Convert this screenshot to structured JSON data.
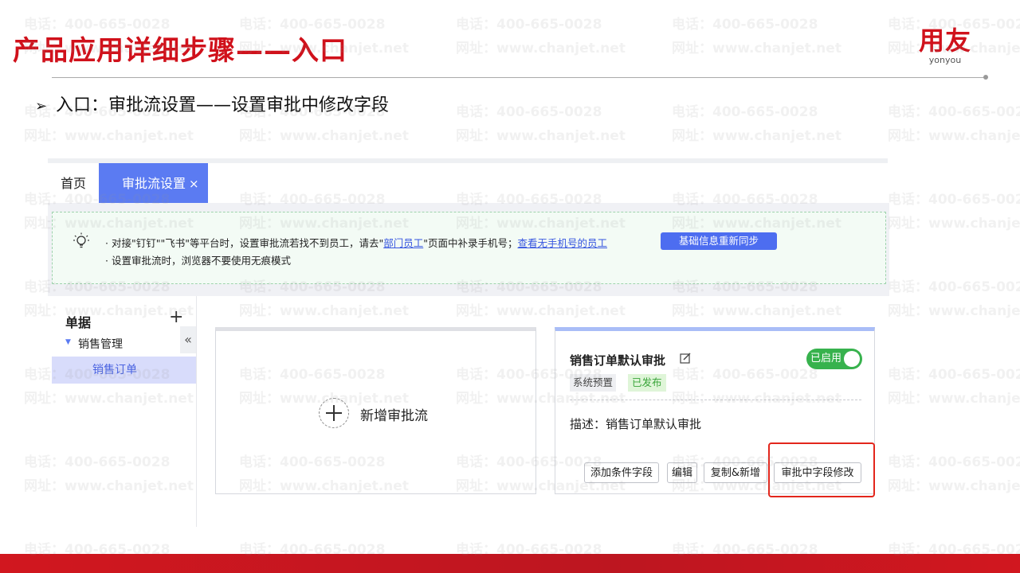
{
  "slide": {
    "title": "产品应用详细步骤——入口",
    "bullet": "入口：审批流设置——设置审批中修改字段",
    "logo_text": "用友",
    "logo_sub": "yonyou",
    "watermark_phone": "电话：400-665-0028",
    "watermark_site": "网址：www.chanjet.net",
    "brand_color": "#d0111b"
  },
  "app": {
    "tabs": [
      {
        "label": "首页",
        "active": false
      },
      {
        "label": "审批流设置",
        "active": true,
        "close": "×"
      }
    ],
    "notice": {
      "line1_a": "· 对接\"钉钉\"\"飞书\"等平台时，设置审批流若找不到员工，请去\"",
      "line1_link1": "部门员工",
      "line1_b": "\"页面中补录手机号；",
      "line1_link2": "查看无手机号的员工",
      "sync_button": "基础信息重新同步",
      "line2": "· 设置审批流时，浏览器不要使用无痕模式"
    },
    "sidebar": {
      "title": "单据",
      "add": "+",
      "collapse": "«",
      "group": "销售管理",
      "item": "销售订单"
    },
    "new_card": {
      "label": "新增审批流"
    },
    "flow_card": {
      "title": "销售订单默认审批",
      "toggle_label": "已启用",
      "toggle_on": true,
      "tag_system": "系统预置",
      "tag_published": "已发布",
      "description": "描述：销售订单默认审批",
      "buttons": [
        "添加条件字段",
        "编辑",
        "复制&新增",
        "审批中字段修改"
      ]
    },
    "accent_color": "#5b7bf2",
    "highlight_color": "#e3261c"
  }
}
